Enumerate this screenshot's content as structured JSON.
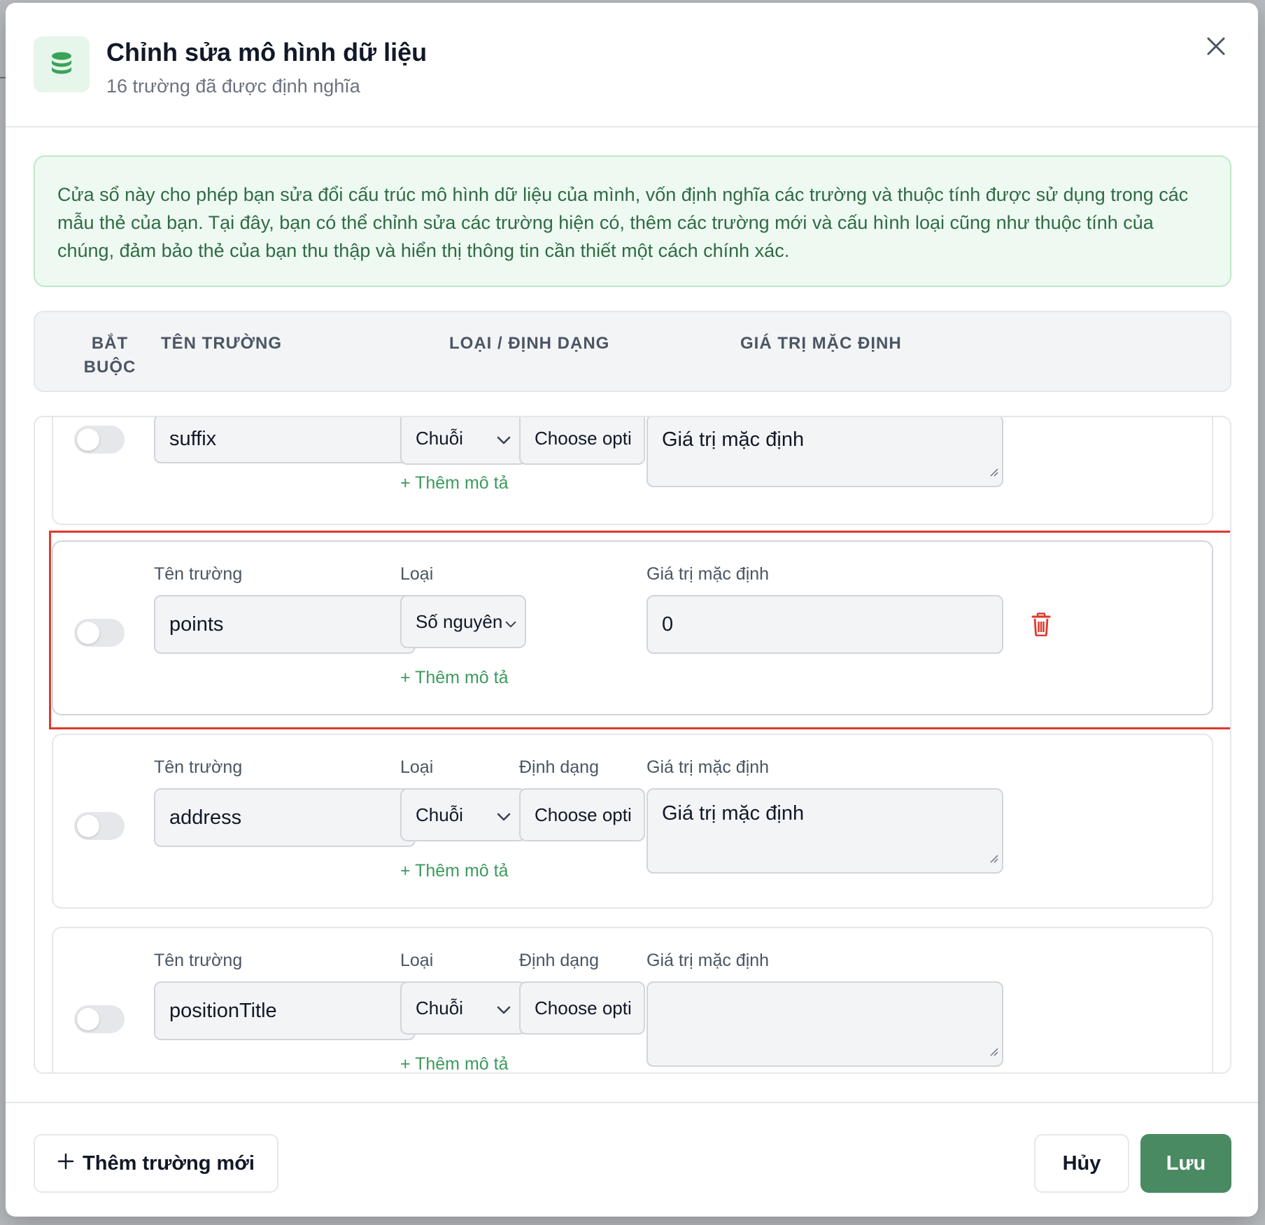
{
  "header": {
    "title": "Chỉnh sửa mô hình dữ liệu",
    "subtitle": "16 trường đã được định nghĩa"
  },
  "info_text": "Cửa sổ này cho phép bạn sửa đổi cấu trúc mô hình dữ liệu của mình, vốn định nghĩa các trường và thuộc tính được sử dụng trong các mẫu thẻ của bạn. Tại đây, bạn có thể chỉnh sửa các trường hiện có, thêm các trường mới và cấu hình loại cũng như thuộc tính của chúng, đảm bảo thẻ của bạn thu thập và hiển thị thông tin cần thiết một cách chính xác.",
  "table_header": {
    "required": "BẮT BUỘC",
    "field_name": "TÊN TRƯỜNG",
    "type_format": "LOẠI / ĐỊNH DẠNG",
    "default_value": "GIÁ TRỊ MẶC ĐỊNH"
  },
  "labels": {
    "field_name": "Tên trường",
    "type": "Loại",
    "format": "Định dạng",
    "default_value": "Giá trị mặc định",
    "add_description": "+ Thêm mô tả"
  },
  "rows": [
    {
      "name": "suffix",
      "type": "Chuỗi",
      "format": "Choose opti",
      "default_placeholder": "Giá trị mặc định",
      "default_value": ""
    },
    {
      "name": "points",
      "type": "Số nguyên",
      "default_value": "0"
    },
    {
      "name": "address",
      "type": "Chuỗi",
      "format": "Choose opti",
      "default_placeholder": "Giá trị mặc định",
      "default_value": ""
    },
    {
      "name": "positionTitle",
      "type": "Chuỗi",
      "format": "Choose opti",
      "default_placeholder": "",
      "default_value": ""
    }
  ],
  "footer": {
    "add_field": "Thêm trường mới",
    "cancel": "Hủy",
    "save": "Lưu"
  },
  "colors": {
    "accent": "#4a8a63",
    "danger": "#dc3a2e",
    "info_bg": "#eefaf1"
  },
  "icons": {
    "header": "database-icon",
    "close": "close-icon",
    "delete": "trash-icon",
    "add": "plus-icon"
  }
}
